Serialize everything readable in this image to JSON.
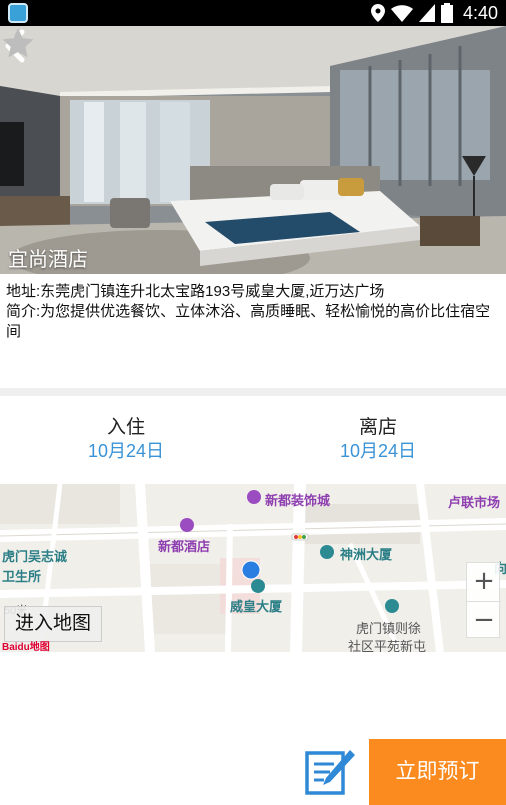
{
  "status_bar": {
    "time": "4:40",
    "icons": [
      "location-icon",
      "wifi-icon",
      "signal-icon",
      "battery-icon"
    ]
  },
  "hotel": {
    "name": "宜尚酒店",
    "address": "地址:东莞虎门镇连升北太宝路193号威皇大厦,近万达广场",
    "intro": "简介:为您提供优选餐饮、立体沐浴、高质睡眠、轻松愉悦的高价比住宿空间"
  },
  "dates": {
    "checkin_label": "入住",
    "checkin_value": "10月24日",
    "checkout_label": "离店",
    "checkout_value": "10月24日"
  },
  "map": {
    "labels": {
      "xindu_mall": "新都装饰城",
      "lulian_market": "卢联市场",
      "xindu_hotel": "新都酒店",
      "humen_wu_1": "虎门吴志诚",
      "humen_wu_2": "卫生所",
      "shenzhou": "神洲大厦",
      "weihuang": "威皇大厦",
      "pingyuan_1": "虎门镇则徐",
      "pingyuan_2": "社区平苑新屯",
      "edge_right": "向"
    },
    "scale": "50米",
    "enter_map": "进入地图",
    "logo": "Baidu地图",
    "zoom_in": "+",
    "zoom_out": "−"
  },
  "actions": {
    "book": "立即预订"
  },
  "colors": {
    "accent_blue": "#3a93d6",
    "book_orange": "#fb8a1f",
    "poi_purple": "#8e3fb0",
    "poi_teal": "#2c7f86"
  }
}
